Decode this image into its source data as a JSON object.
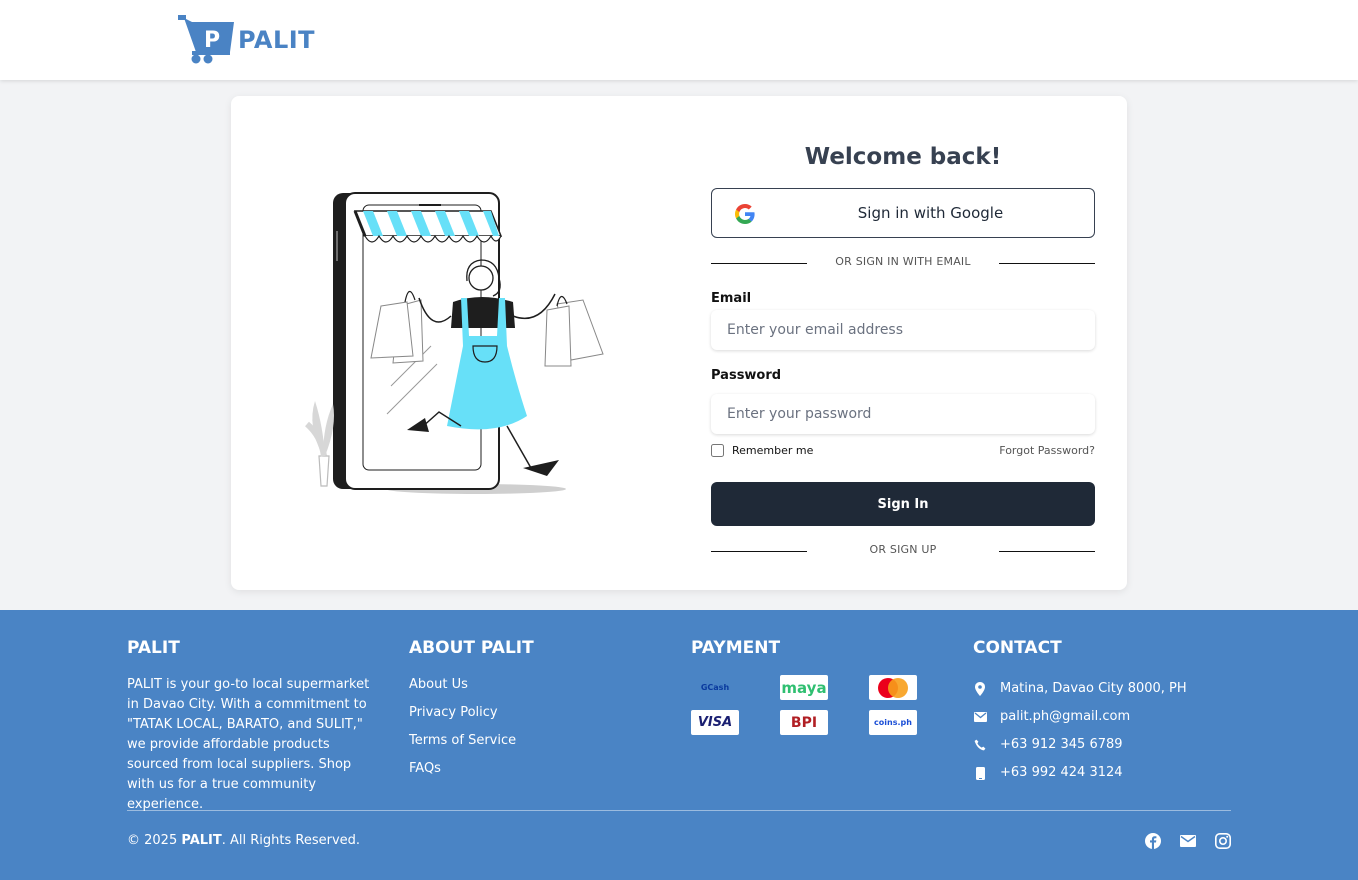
{
  "header": {
    "logo_letter": "P",
    "logo_text": "PALIT"
  },
  "login": {
    "title": "Welcome back!",
    "google_label": "Sign in with Google",
    "divider_email": "OR SIGN IN WITH EMAIL",
    "email_label": "Email",
    "email_placeholder": "Enter your email address",
    "password_label": "Password",
    "password_placeholder": "Enter your password",
    "remember_label": "Remember me",
    "forgot_label": "Forgot Password?",
    "signin_label": "Sign In",
    "divider_signup": "OR SIGN UP"
  },
  "footer": {
    "about": {
      "title": "PALIT",
      "text": "PALIT is your go-to local supermarket in Davao City. With a commitment to \"TATAK LOCAL, BARATO, and SULIT,\" we provide affordable products sourced from local suppliers. Shop with us for a true community experience."
    },
    "links": {
      "title": "ABOUT PALIT",
      "items": [
        "About Us",
        "Privacy Policy",
        "Terms of Service",
        "FAQs"
      ]
    },
    "payment": {
      "title": "PAYMENT",
      "methods": [
        "GCash",
        "maya",
        "mastercard",
        "VISA",
        "BPI",
        "coins.ph"
      ]
    },
    "contact": {
      "title": "CONTACT",
      "address": "Matina, Davao City 8000, PH",
      "email": "palit.ph@gmail.com",
      "phone": "+63 912 345 6789",
      "mobile": "+63 992 424 3124"
    },
    "copyright_prefix": "© 2025 ",
    "copyright_brand": "PALIT",
    "copyright_suffix": ". All Rights Reserved.",
    "social": [
      "facebook-icon",
      "mail-icon",
      "instagram-icon"
    ]
  },
  "colors": {
    "brand_blue": "#4a84c5",
    "dark_button": "#1f2937",
    "apron_cyan": "#67e0f8"
  }
}
